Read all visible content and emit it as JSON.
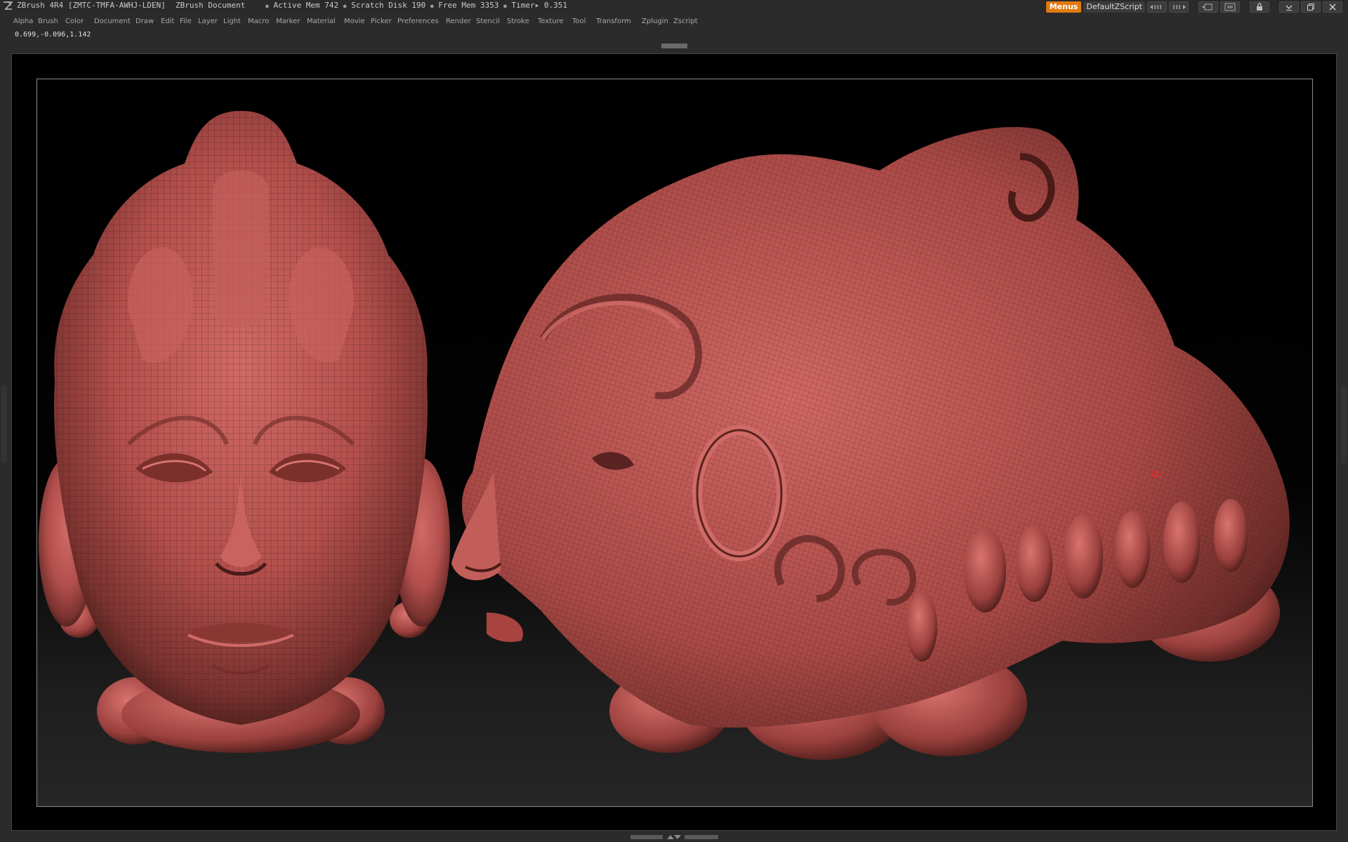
{
  "titlebar": {
    "app_name": "ZBrush 4R4 [ZMTC-TMFA-AWHJ-LDEN]",
    "document_name": "ZBrush Document",
    "active_mem": "Active Mem 742",
    "scratch_disk": "Scratch Disk 190",
    "free_mem": "Free Mem 3353",
    "timer": "Timer▸ 0.351",
    "menus_label": "Menus",
    "script_label": "DefaultZScript"
  },
  "menu": {
    "items": [
      "Alpha",
      "Brush",
      "Color",
      "Document",
      "Draw",
      "Edit",
      "File",
      "Layer",
      "Light",
      "Macro",
      "Marker",
      "Material",
      "Movie",
      "Picker",
      "Preferences",
      "Render",
      "Stencil",
      "Stroke",
      "Texture",
      "Tool",
      "Transform",
      "Zplugin",
      "Zscript"
    ]
  },
  "status": {
    "coordinates": "0.699,-0.096,1.142"
  },
  "colors": {
    "accent": "#e07a10",
    "model": "#b85552",
    "model_dark": "#5a2420",
    "background": "#2b2b2b"
  },
  "icons": [
    "zbrush-logo-icon",
    "palette-popup-icon",
    "palette-scroll-icon",
    "zoom-document-icon",
    "restore-layout-icon",
    "lock-icon",
    "minimize-icon",
    "restore-window-icon",
    "close-icon"
  ]
}
